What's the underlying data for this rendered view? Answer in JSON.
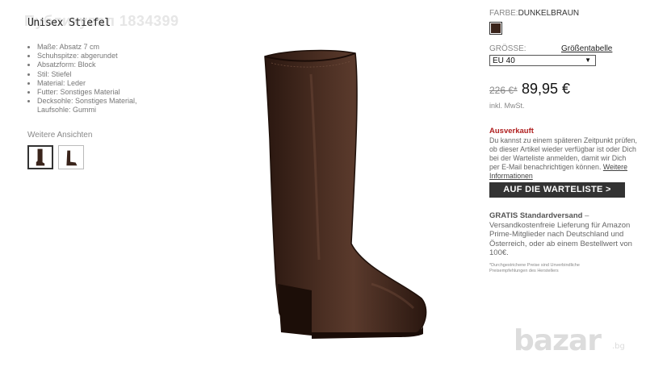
{
  "watermark": "Публикувал 1834399",
  "product": {
    "title": "Unisex Stiefel",
    "attributes": [
      "Maße: Absatz 7 cm",
      "Schuhspitze: abgerundet",
      "Absatzform: Block",
      "Stil: Stiefel",
      "Material: Leder",
      "Futter: Sonstiges Material",
      "Decksohle: Sonstiges Material, Laufsohle: Gummi"
    ],
    "more_views_label": "Weitere Ansichten"
  },
  "color": {
    "label": "FARBE:",
    "value": "DUNKELBRAUN",
    "swatch_hex": "#3a241b"
  },
  "size": {
    "label": "GRÖSSE:",
    "chart_link": "Größentabelle",
    "selected": "EU 40"
  },
  "price": {
    "old": "226 €*",
    "new": "89,95 €",
    "tax_note": "inkl. MwSt."
  },
  "availability": {
    "status": "Ausverkauft",
    "text": "Du kannst zu einem späteren Zeitpunkt prüfen, ob dieser Artikel wieder verfügbar ist oder Dich bei der Warteliste anmelden, damit wir Dich per E-Mail benachrichtigen können.",
    "link": "Weitere Informationen",
    "button": "AUF DIE WARTELISTE >"
  },
  "shipping": {
    "title": "GRATIS Standardversand",
    "text": "– Versandkostenfreie Lieferung für Amazon Prime-Mitglieder nach Deutschland und Österreich, oder ab einem Bestellwert von 100€."
  },
  "footnote": "*Durchgestrichene Preise sind Unverbindliche Preisempfehlungen des Herstellers",
  "logo": {
    "text": "bazar",
    "suffix": ".bg"
  }
}
